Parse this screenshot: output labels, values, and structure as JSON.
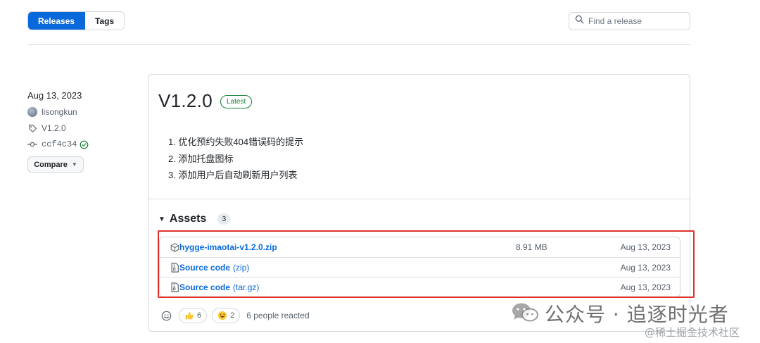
{
  "tabs": [
    {
      "label": "Releases",
      "active": true
    },
    {
      "label": "Tags",
      "active": false
    }
  ],
  "search": {
    "placeholder": "Find a release",
    "icon": "search-icon"
  },
  "meta": {
    "date": "Aug 13, 2023",
    "author": "lisongkun",
    "tag": "V1.2.0",
    "commit": "ccf4c34",
    "compare_label": "Compare"
  },
  "release": {
    "title": "V1.2.0",
    "badge": "Latest",
    "notes": [
      "1. 优化预约失败404错误码的提示",
      "2. 添加托盘图标",
      "3. 添加用户后自动刷新用户列表"
    ]
  },
  "assets": {
    "heading": "Assets",
    "count": "3",
    "items": [
      {
        "icon": "package-icon",
        "name": "hygge-imaotai-v1.2.0.zip",
        "suffix": "",
        "size": "8.91 MB",
        "date": "Aug 13, 2023"
      },
      {
        "icon": "file-zip-icon",
        "name": "Source code",
        "suffix": "(zip)",
        "size": "",
        "date": "Aug 13, 2023"
      },
      {
        "icon": "file-zip-icon",
        "name": "Source code",
        "suffix": "(tar.gz)",
        "size": "",
        "date": "Aug 13, 2023"
      }
    ]
  },
  "reactions": {
    "items": [
      {
        "icon": "thumbs-up-icon",
        "count": "6"
      },
      {
        "icon": "laugh-icon",
        "count": "2"
      }
    ],
    "summary": "6 people reacted"
  },
  "watermark": {
    "primary": "公众号 · 追逐时光者",
    "secondary": "@稀土掘金技术社区"
  },
  "colors": {
    "accent": "#0969da",
    "latest": "#1a7f37",
    "highlight": "#e0302a"
  }
}
